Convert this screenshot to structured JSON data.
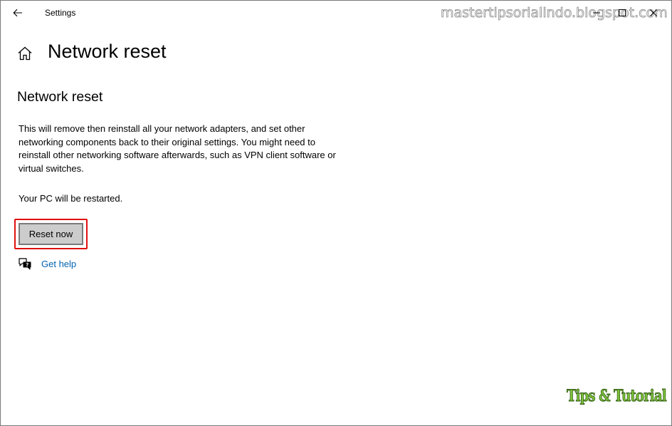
{
  "window": {
    "app_title": "Settings",
    "controls": {
      "minimize": "minimize-icon",
      "maximize": "maximize-icon",
      "close": "close-icon"
    }
  },
  "watermarks": {
    "top": "mastertipsorialindo.blogspot.com",
    "bottom": "Tips & Tutorial"
  },
  "page": {
    "title": "Network reset",
    "section_title": "Network reset",
    "description": "This will remove then reinstall all your network adapters, and set other networking components back to their original settings. You might need to reinstall other networking software afterwards, such as VPN client software or virtual switches.",
    "restart_note": "Your PC will be restarted.",
    "reset_button_label": "Reset now",
    "help_link_label": "Get help"
  },
  "colors": {
    "link": "#0063b1",
    "highlight": "#e01010",
    "button_bg": "#cccccc",
    "button_border": "#7a7a7a",
    "watermark_green": "#7cc23a"
  }
}
